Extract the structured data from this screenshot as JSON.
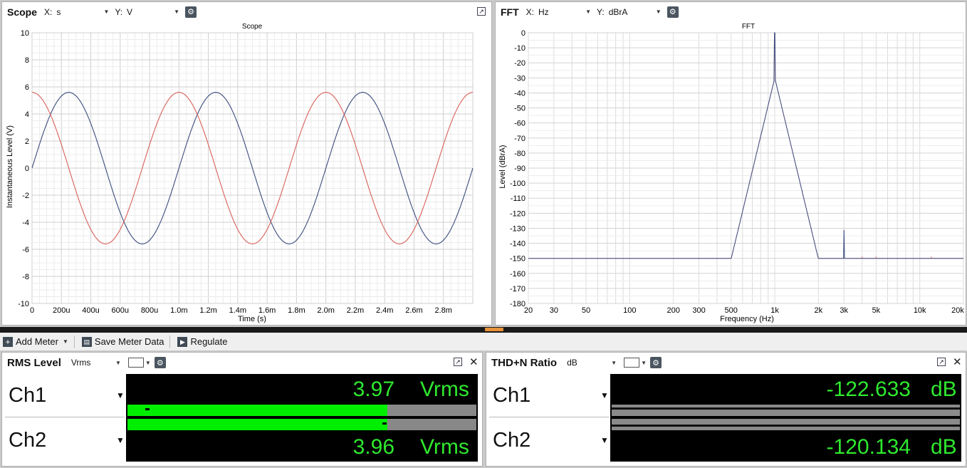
{
  "scope": {
    "title": "Scope",
    "x_label": "X:",
    "x_unit": "s",
    "y_label": "Y:",
    "y_unit": "V",
    "chart_data": {
      "type": "line",
      "title": "Scope",
      "xlabel": "Time (s)",
      "ylabel": "Instantaneous Level (V)",
      "xlim": [
        0,
        0.003
      ],
      "ylim": [
        -10,
        10
      ],
      "x_tick_labels": [
        "0",
        "200u",
        "400u",
        "600u",
        "800u",
        "1.0m",
        "1.2m",
        "1.4m",
        "1.6m",
        "1.8m",
        "2.0m",
        "2.2m",
        "2.4m",
        "2.6m",
        "2.8m"
      ],
      "y_tick_labels": [
        "10",
        "8",
        "6",
        "4",
        "2",
        "0",
        "-2",
        "-4",
        "-6",
        "-8",
        "-10"
      ],
      "grid": true,
      "series": [
        {
          "color": "#3c4c7e",
          "waveform": "sine",
          "amplitude": 5.6,
          "frequency_hz": 1000,
          "phase_deg": 0
        },
        {
          "color": "#d9605a",
          "waveform": "sine",
          "amplitude": 5.6,
          "frequency_hz": 1000,
          "phase_deg": 90
        }
      ]
    }
  },
  "fft": {
    "title": "FFT",
    "x_label": "X:",
    "x_unit": "Hz",
    "y_label": "Y:",
    "y_unit": "dBrA",
    "chart_data": {
      "type": "line",
      "title": "FFT",
      "xlabel": "Frequency (Hz)",
      "ylabel": "Level (dBrA)",
      "xscale": "log",
      "xlim": [
        20,
        20000
      ],
      "ylim": [
        -180,
        0
      ],
      "x_tick_labels": [
        "20",
        "30",
        "50",
        "100",
        "200",
        "300",
        "500",
        "1k",
        "2k",
        "3k",
        "5k",
        "10k",
        "20k"
      ],
      "y_tick_labels": [
        "0",
        "-10",
        "-20",
        "-30",
        "-40",
        "-50",
        "-60",
        "-70",
        "-80",
        "-90",
        "-100",
        "-110",
        "-120",
        "-130",
        "-140",
        "-150",
        "-160",
        "-170",
        "-180"
      ],
      "grid": true,
      "series": [
        {
          "color": "#3c4c7e",
          "fundamental_hz": 1000,
          "fundamental_db": 0,
          "noise_floor_db": -158,
          "harmonics": [
            {
              "f": 2000,
              "db": -153
            },
            {
              "f": 3000,
              "db": -131
            },
            {
              "f": 4000,
              "db": -157
            },
            {
              "f": 5000,
              "db": -155
            },
            {
              "f": 7000,
              "db": -155
            },
            {
              "f": 9000,
              "db": -150
            },
            {
              "f": 11000,
              "db": -152
            },
            {
              "f": 13000,
              "db": -152
            },
            {
              "f": 15000,
              "db": -152
            }
          ]
        },
        {
          "color": "#f0a8a8",
          "fundamental_hz": 1000,
          "fundamental_db": 0,
          "noise_floor_db": -160,
          "harmonics": [
            {
              "f": 2000,
              "db": -152
            },
            {
              "f": 3000,
              "db": -150
            },
            {
              "f": 4000,
              "db": -149
            },
            {
              "f": 5000,
              "db": -149
            },
            {
              "f": 6000,
              "db": -150
            },
            {
              "f": 8000,
              "db": -151
            },
            {
              "f": 10000,
              "db": -151
            },
            {
              "f": 12000,
              "db": -149
            },
            {
              "f": 14000,
              "db": -151
            },
            {
              "f": 16000,
              "db": -151
            },
            {
              "f": 18000,
              "db": -151
            }
          ]
        }
      ]
    }
  },
  "toolbar": {
    "add_meter": "Add Meter",
    "save_meter_data": "Save Meter Data",
    "regulate": "Regulate"
  },
  "rms": {
    "title": "RMS Level",
    "unit_select": "Vrms",
    "channels": [
      {
        "label": "Ch1",
        "value": "3.97",
        "unit": "Vrms",
        "bar_fraction": 0.745,
        "peak_fraction": 0.05
      },
      {
        "label": "Ch2",
        "value": "3.96",
        "unit": "Vrms",
        "bar_fraction": 0.745,
        "peak_fraction": 0.73
      }
    ]
  },
  "thdn": {
    "title": "THD+N Ratio",
    "unit_select": "dB",
    "channels": [
      {
        "label": "Ch1",
        "value": "-122.633",
        "unit": "dB"
      },
      {
        "label": "Ch2",
        "value": "-120.134",
        "unit": "dB"
      }
    ]
  }
}
